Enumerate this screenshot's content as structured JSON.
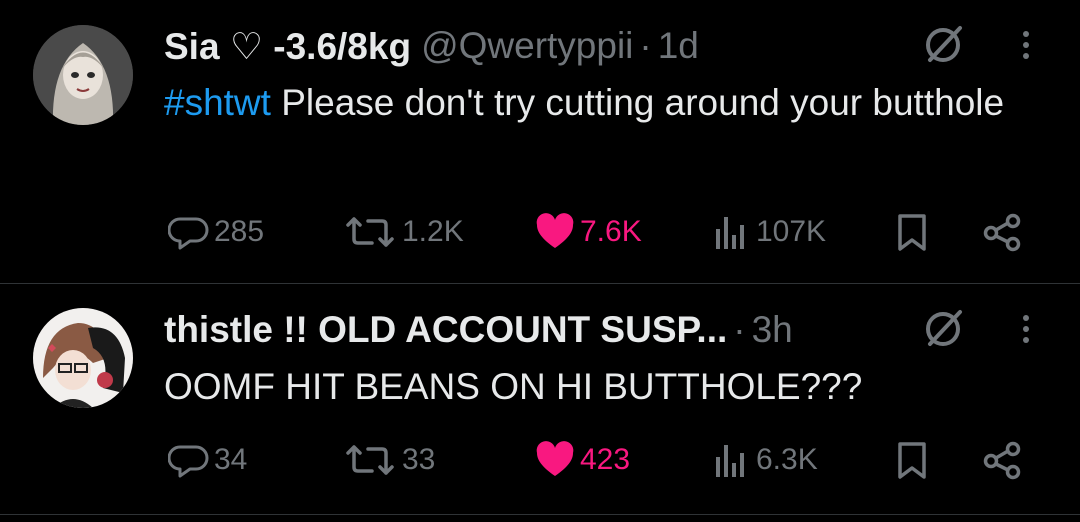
{
  "posts": [
    {
      "author_name": "Sia ♡ -3.6/8kg",
      "handle": "@Qwertyppii",
      "time": "1d",
      "hashtag": "#shtwt",
      "text": " Please don't try cutting around your butthole",
      "replies": "285",
      "reposts": "1.2K",
      "likes": "7.6K",
      "views": "107K",
      "liked": true
    },
    {
      "author_name": "thistle !! OLD ACCOUNT SUSP...",
      "handle": "",
      "time": "3h",
      "hashtag": "",
      "text": "OOMF HIT BEANS ON HI BUTTHOLE???",
      "replies": "34",
      "reposts": "33",
      "likes": "423",
      "views": "6.3K",
      "liked": true
    }
  ],
  "colors": {
    "background": "#000000",
    "text": "#e7e9ea",
    "muted": "#71767b",
    "link": "#1d9bf0",
    "like": "#f91880",
    "divider": "#2f3336"
  },
  "icons": [
    "grok-icon",
    "more-icon",
    "reply-icon",
    "repost-icon",
    "heart-icon",
    "views-icon",
    "bookmark-icon",
    "share-icon"
  ]
}
